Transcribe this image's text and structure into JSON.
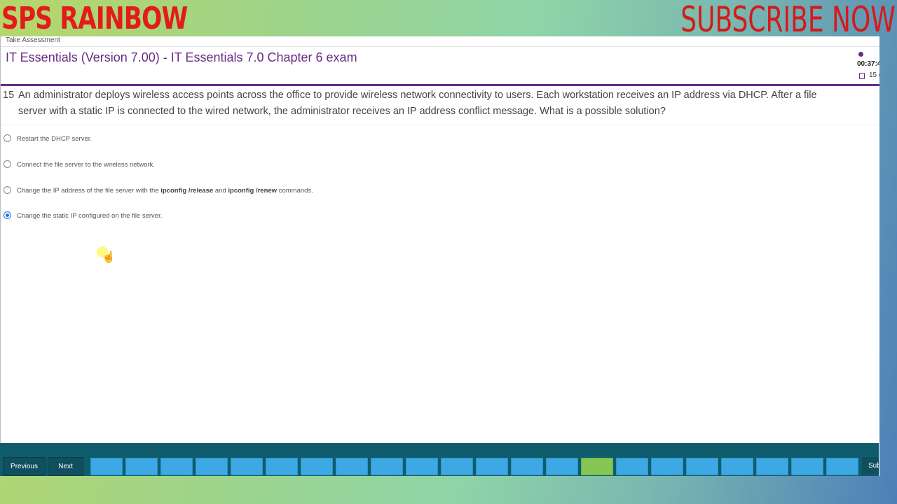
{
  "watermark": {
    "left": "SPS RAINBOW",
    "right": "SUBSCRIBE NOW"
  },
  "header": {
    "take_assessment": "Take Assessment",
    "title": "IT Essentials (Version 7.00) - IT Essentials 7.0 Chapter 6 exam",
    "timer": "00:37:4",
    "count": "15 o"
  },
  "question": {
    "number": "15",
    "text": "An administrator deploys wireless access points across the office to provide wireless network connectivity to users. Each workstation receives an IP address via DHCP. After a file server with a static IP is connected to the wired network, the administrator receives an IP address conflict message. What is a possible solution?"
  },
  "options": [
    {
      "label": "Restart the DHCP server.",
      "selected": false
    },
    {
      "label": "Connect the file server to the wireless network.",
      "selected": false
    },
    {
      "label_pre": "Change the IP address of the file server with the ",
      "label_b1": "ipconfig /release",
      "label_mid": " and ",
      "label_b2": "ipconfig /renew",
      "label_post": " commands.",
      "selected": false
    },
    {
      "label": "Change the static IP configured on the file server.",
      "selected": true
    }
  ],
  "nav": {
    "previous": "Previous",
    "next": "Next",
    "submit": "Submit",
    "question_boxes": 22,
    "current_index": 14
  },
  "colors": {
    "accent": "#6b2c83",
    "nav_bar": "#0f5d6c",
    "question_box": "#3da8e3",
    "current_box": "#84c755"
  }
}
